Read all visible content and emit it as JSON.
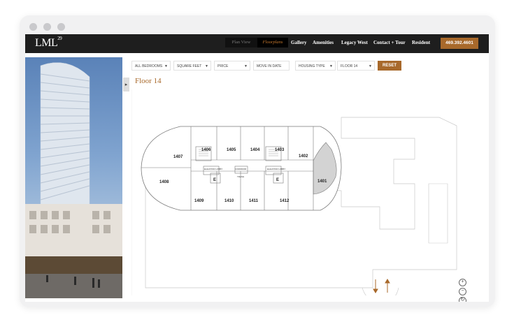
{
  "nav": {
    "logo_main": "LML",
    "logo_sup": "29",
    "plan_view": "Plan View",
    "floorplans": "Floorplans",
    "items": [
      "Gallery",
      "Amenities",
      "Legacy West",
      "Contact + Tour",
      "Resident"
    ],
    "phone": "469.392.4601"
  },
  "filters": {
    "bedrooms": "ALL BEDROOMS",
    "square_feet": "SQUARE FEET",
    "price": "PRICE",
    "move_in": "MOVE IN DATE",
    "housing_type": "HOUSING TYPE",
    "floor": "FLOOR 14",
    "reset": "RESET"
  },
  "floor_title": "Floor 14",
  "units": [
    "1401",
    "1402",
    "1403",
    "1404",
    "1405",
    "1406",
    "1407",
    "1408",
    "1409",
    "1410",
    "1411",
    "1412"
  ],
  "plan_labels": {
    "elevator_lobby_1": "ELEVATOR LOBBY",
    "elevator_lobby_2": "ELEVATOR LOBBY",
    "corridor": "CORRIDOR",
    "trash": "TRASH",
    "e": "E"
  },
  "zoom": {
    "in": "+",
    "out": "−",
    "reset": "↻"
  },
  "colors": {
    "accent": "#a8692b",
    "nav_bg": "#1e1e1e",
    "selected_unit": "#d3d3d3"
  }
}
